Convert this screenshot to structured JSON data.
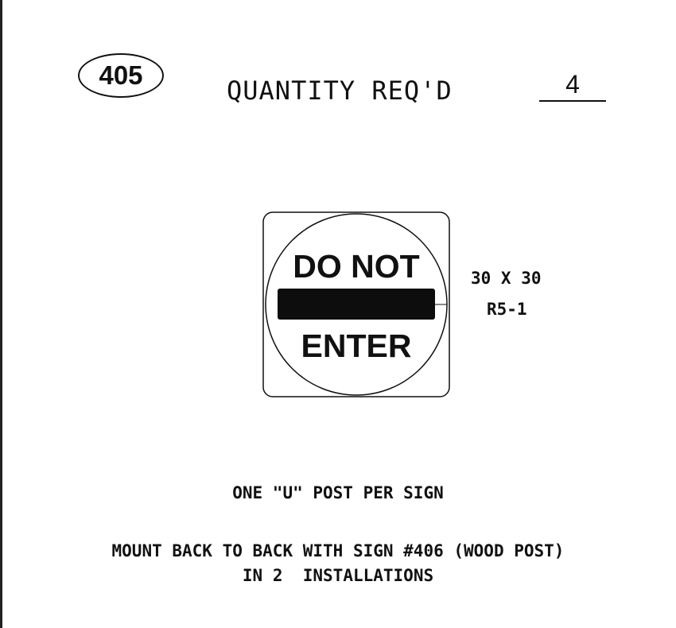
{
  "sheet": {
    "sign_number": "405",
    "quantity_label": "QUANTITY REQ'D",
    "quantity_value": "4"
  },
  "sign": {
    "top_text": "DO NOT",
    "bottom_text": "ENTER",
    "size": "30 X 30",
    "code": "R5-1"
  },
  "notes": {
    "post": "ONE \"U\" POST PER SIGN",
    "mount": "MOUNT BACK TO BACK WITH SIGN #406 (WOOD POST)",
    "installations": "IN 2  INSTALLATIONS"
  }
}
